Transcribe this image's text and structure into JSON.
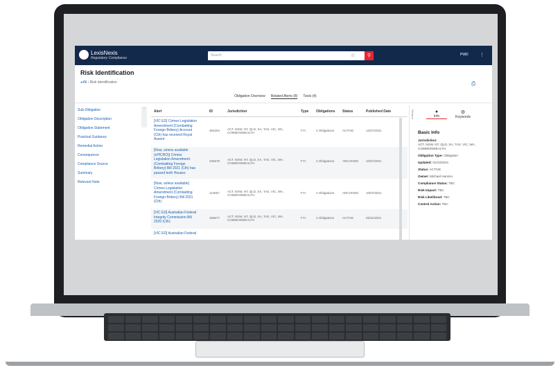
{
  "app": {
    "brand": "LexisNexis",
    "sub": "Regulatory Compliance",
    "search_placeholder": "Search",
    "user": "PWD"
  },
  "page": {
    "title": "Risk Identification",
    "breadcrumb_back": "All",
    "breadcrumb_current": "Risk Identification"
  },
  "tabs": [
    "Obligation Overview",
    "Related Alerts (8)",
    "Tools (4)"
  ],
  "left_nav": [
    "Sub-Obligation",
    "Obligation Description",
    "Obligation Statement",
    "Practical Guidance",
    "Remedial Action",
    "Consequence",
    "Compliance Source",
    "Summary",
    "Relevant Note"
  ],
  "table": {
    "headers": [
      "Alert",
      "ID",
      "Jurisdiction",
      "Type",
      "Obligations",
      "Status",
      "Published Date"
    ],
    "rows": [
      {
        "alert": "[VIC ED] Crimes Legislation Amendment (Combatting Foreign Bribery) Account (Cth) has received Royal Assent",
        "id": "364294",
        "jurisdiction": "ACT, NSW, NT, QLD, SA, TAS, VIC, WA, COMMONWEALTH",
        "type": "FYI",
        "obligations": "4 Obligations",
        "status": "ACTIVE",
        "date": "12/07/2021"
      },
      {
        "alert": "[Now, unless available (ePICRO)] Crimes Legislation Amendment (Combatting Foreign Bribery) Bill 2021 (Cth) has passed both Houses",
        "id": "345678",
        "jurisdiction": "ACT, NSW, NT, QLD, SA, TAS, VIC, WA, COMMONWEALTH",
        "type": "FYI",
        "obligations": "4 Obligations",
        "status": "ARCHIVED",
        "date": "10/07/2021"
      },
      {
        "alert": "[Now, unless available] Crimes Legislation Amendment (Combatting Foreign Bribery) Bill 2021 (Cth)",
        "id": "114567",
        "jurisdiction": "ACT, NSW, NT, QLD, SA, TAS, VIC, WA, COMMONWEALTH",
        "type": "FYI",
        "obligations": "4 Obligations",
        "status": "ARCHIVED",
        "date": "10/07/2021"
      },
      {
        "alert": "[VIC ED] Australian Federal Integrity Commission Bill 2020 (Cth)",
        "id": "456677",
        "jurisdiction": "ACT, NSW, NT, QLD, SA, TAS, VIC, WA, COMMONWEALTH",
        "type": "FYI",
        "obligations": "4 Obligations",
        "status": "ACTIVE",
        "date": "02/11/2021"
      },
      {
        "alert": "[VIC ED] Australian Federal",
        "id": "",
        "jurisdiction": "",
        "type": "",
        "obligations": "",
        "status": "",
        "date": ""
      }
    ]
  },
  "right_panel": {
    "vertical_label": "Related",
    "tab_info": "Info",
    "tab_keywords": "Keywords",
    "title": "Basic Info",
    "fields": [
      {
        "label": "Jurisdiction:",
        "value": "ACT, NSW, NT, QLD, SA, TAS, VIC, WA, COMMONWEALTH"
      },
      {
        "label": "Obligation Type:",
        "value": "Obligation"
      },
      {
        "label": "Updated:",
        "value": "01/10/2021"
      },
      {
        "label": "Status:",
        "value": "ACTIVE"
      },
      {
        "label": "Owner:",
        "value": "Michael Hanson"
      },
      {
        "label": "Compliance Status:",
        "value": "TBC"
      },
      {
        "label": "Risk Impact:",
        "value": "TBC"
      },
      {
        "label": "Risk Likelihood:",
        "value": "TBC"
      },
      {
        "label": "Control Action:",
        "value": "TBC"
      }
    ]
  },
  "colors": {
    "header_bg": "#13294b",
    "accent_red": "#e32636",
    "link_blue": "#1a5fb4"
  }
}
